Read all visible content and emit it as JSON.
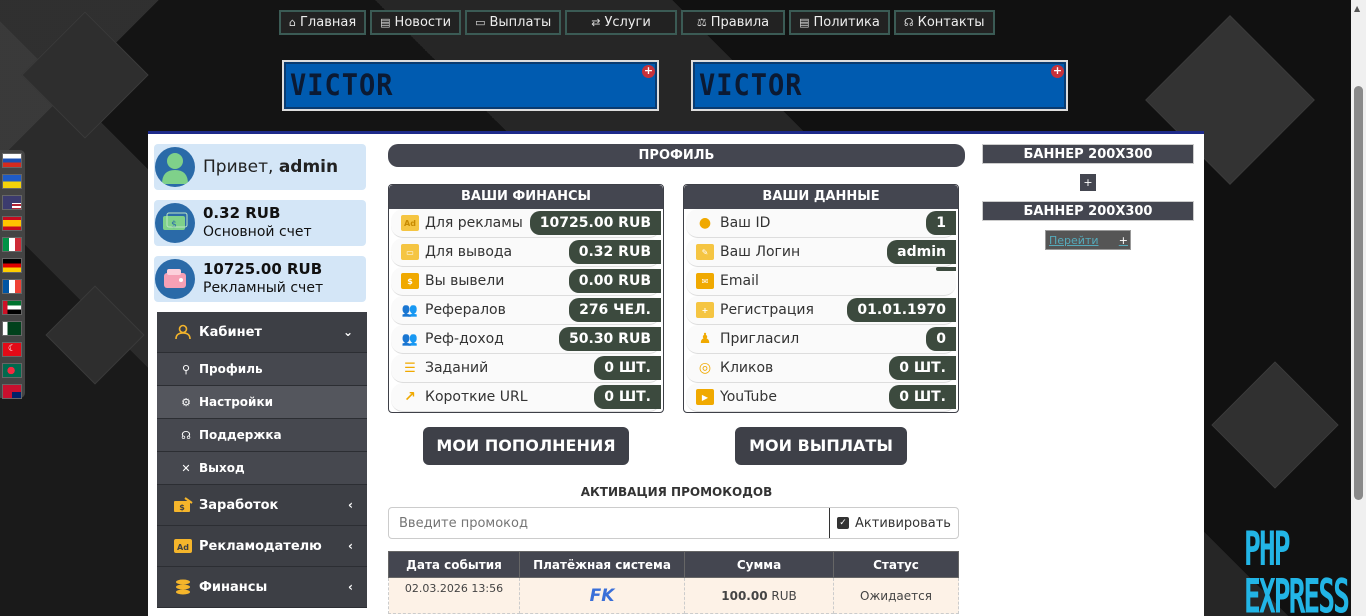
{
  "nav": [
    {
      "label": "Главная",
      "icon": "home-icon",
      "glyph": "⌂"
    },
    {
      "label": "Новости",
      "icon": "news-icon",
      "glyph": "▤"
    },
    {
      "label": "Выплаты",
      "icon": "card-icon",
      "glyph": "▭"
    },
    {
      "label": "Услуги",
      "icon": "exchange-icon",
      "glyph": "⇄"
    },
    {
      "label": "Правила",
      "icon": "scales-icon",
      "glyph": "⚖"
    },
    {
      "label": "Политика",
      "icon": "document-icon",
      "glyph": "▤"
    },
    {
      "label": "Контакты",
      "icon": "headset-icon",
      "glyph": "☊"
    }
  ],
  "banners": {
    "top_left": "VICTOR",
    "top_right": "VICTOR"
  },
  "user": {
    "greeting": "Привет,",
    "name": "admin",
    "main_balance": "0.32 RUB",
    "main_label": "Основной счет",
    "ad_balance": "10725.00 RUB",
    "ad_label": "Рекламный счет"
  },
  "menu": {
    "cabinet": "Кабинет",
    "profile": "Профиль",
    "settings": "Настройки",
    "support": "Поддержка",
    "logout": "Выход",
    "earnings": "Заработок",
    "advertiser": "Рекламодателю",
    "finance": "Финансы"
  },
  "profile_title": "ПРОФИЛЬ",
  "finances": {
    "title": "ВАШИ ФИНАНСЫ",
    "rows": [
      {
        "label": "Для рекламы",
        "value": "10725.00 RUB"
      },
      {
        "label": "Для вывода",
        "value": "0.32 RUB"
      },
      {
        "label": "Вы вывели",
        "value": "0.00 RUB"
      },
      {
        "label": "Рефералов",
        "value": "276 ЧЕЛ."
      },
      {
        "label": "Реф-доход",
        "value": "50.30 RUB"
      },
      {
        "label": "Заданий",
        "value": "0 ШТ."
      },
      {
        "label": "Короткие URL",
        "value": "0 ШТ."
      }
    ]
  },
  "mydata": {
    "title": "ВАШИ ДАННЫЕ",
    "rows": [
      {
        "label": "Ваш ID",
        "value": "1"
      },
      {
        "label": "Ваш Логин",
        "value": "admin"
      },
      {
        "label": "Email",
        "value": ""
      },
      {
        "label": "Регистрация",
        "value": "01.01.1970"
      },
      {
        "label": "Пригласил",
        "value": "0"
      },
      {
        "label": "Кликов",
        "value": "0 ШТ."
      },
      {
        "label": "YouTube",
        "value": "0 ШТ."
      }
    ]
  },
  "buttons": {
    "deposits": "МОИ ПОПОЛНЕНИЯ",
    "payouts": "МОИ ВЫПЛАТЫ"
  },
  "promo": {
    "title": "АКТИВАЦИЯ ПРОМОКОДОВ",
    "placeholder": "Введите промокод",
    "activate": "Активировать"
  },
  "events": {
    "headers": [
      "Дата события",
      "Платёжная система",
      "Сумма",
      "Статус"
    ],
    "rows": [
      {
        "date": "02.03.2026 13:56",
        "system": "FK",
        "amount": "100.00",
        "currency": "RUB",
        "status": "Ожидается"
      }
    ]
  },
  "right": {
    "banner1": "БАННЕР 200X300",
    "banner2": "БАННЕР 200X300",
    "link": "Перейти"
  },
  "watermark": "PHP EXPRESS",
  "colors": {
    "accent": "#444650",
    "value_bg": "#3c4a3e",
    "banner_blue": "#005bb0",
    "plus_red": "#c8323a"
  }
}
